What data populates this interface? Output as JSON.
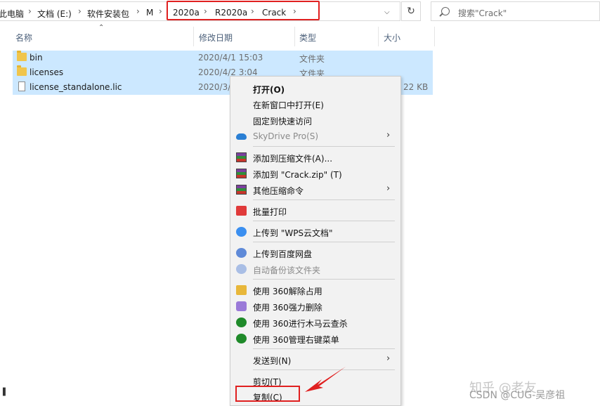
{
  "breadcrumb": {
    "items": [
      "此电脑",
      "文档 (E:)",
      "软件安装包",
      "M",
      "2020a",
      "R2020a",
      "Crack"
    ],
    "separator": "›"
  },
  "toolbar": {
    "refresh_icon": "refresh-icon",
    "dropdown_icon": "chevron-down-icon"
  },
  "search": {
    "placeholder": "搜索\"Crack\""
  },
  "columns": {
    "name": "名称",
    "date": "修改日期",
    "type": "类型",
    "size": "大小"
  },
  "files": [
    {
      "name": "bin",
      "date": "2020/4/1 15:03",
      "type": "文件夹",
      "size": "",
      "icon": "folder-icon"
    },
    {
      "name": "licenses",
      "date": "2020/4/2 3:04",
      "type": "文件夹",
      "size": "",
      "icon": "folder-icon"
    },
    {
      "name": "license_standalone.lic",
      "date": "2020/3/",
      "type": "",
      "size": "22 KB",
      "icon": "file-icon"
    }
  ],
  "context_menu": {
    "open": "打开(O)",
    "open_new_window": "在新窗口中打开(E)",
    "pin_quick_access": "固定到快速访问",
    "skydrive": "SkyDrive Pro(S)",
    "add_to_archive": "添加到压缩文件(A)...",
    "add_to_zip": "添加到 \"Crack.zip\" (T)",
    "other_compress": "其他压缩命令",
    "batch_print": "批量打印",
    "upload_wps": "上传到 \"WPS云文档\"",
    "upload_baidu": "上传到百度网盘",
    "auto_backup": "自动备份该文件夹",
    "unlock_360": "使用 360解除占用",
    "force_delete_360": "使用 360强力删除",
    "trojan_scan_360": "使用 360进行木马云查杀",
    "manage_menu_360": "使用 360管理右键菜单",
    "send_to": "发送到(N)",
    "cut": "剪切(T)",
    "copy": "复制(C)"
  },
  "watermark": {
    "zhihu": "知乎 @老友",
    "csdn": "CSDN @CUG-吴彦祖"
  },
  "colors": {
    "selection": "#cce8ff",
    "highlight_box": "#e02020",
    "menu_bg": "#f2f2f2"
  }
}
